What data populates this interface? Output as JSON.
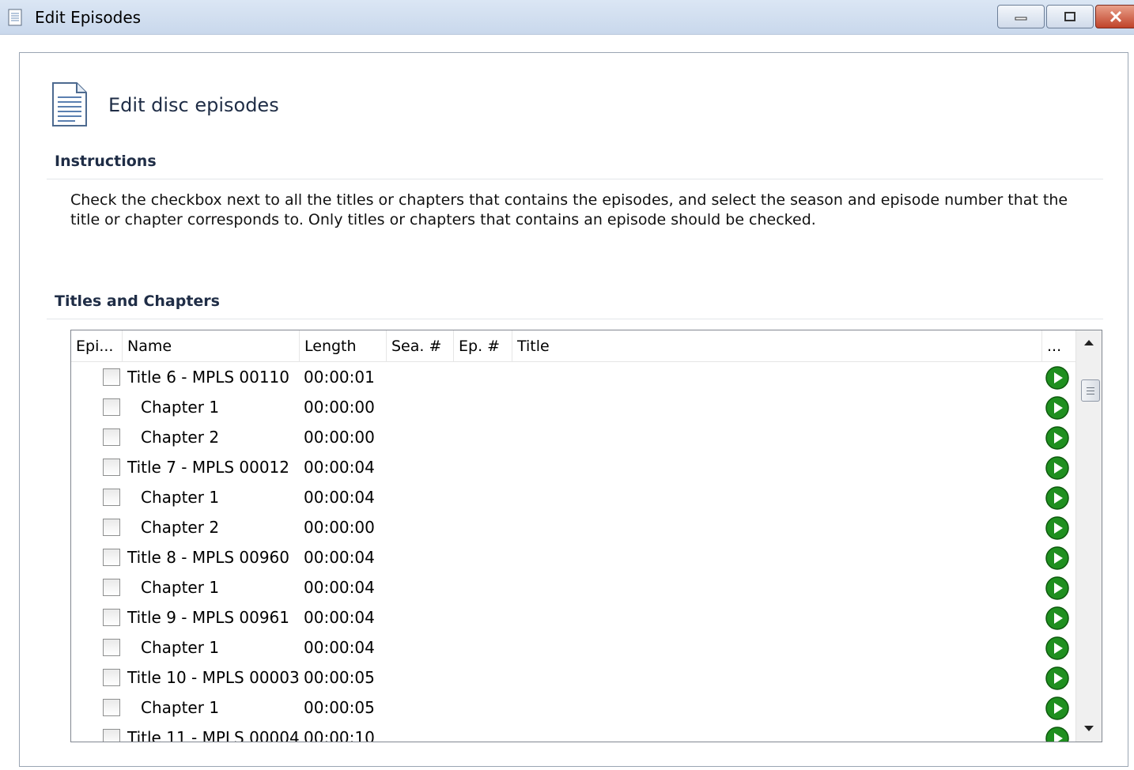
{
  "window": {
    "title": "Edit Episodes"
  },
  "header": {
    "title": "Edit disc episodes"
  },
  "instructions": {
    "label": "Instructions",
    "text": "Check the checkbox next to all the titles or chapters that contains the episodes, and select the season and episode number that the title or chapter corresponds to. Only titles or chapters that contains an episode should be checked."
  },
  "titles_section": {
    "label": "Titles and Chapters"
  },
  "columns": [
    "Epi...",
    "Name",
    "Length",
    "Sea. #",
    "Ep. #",
    "Title",
    "..."
  ],
  "rows": [
    {
      "name": "Title 6 - MPLS 00110",
      "length": "00:00:01",
      "level": 0,
      "checked": false
    },
    {
      "name": "Chapter 1",
      "length": "00:00:00",
      "level": 1,
      "checked": false
    },
    {
      "name": "Chapter 2",
      "length": "00:00:00",
      "level": 1,
      "checked": false
    },
    {
      "name": "Title 7 - MPLS 00012",
      "length": "00:00:04",
      "level": 0,
      "checked": false
    },
    {
      "name": "Chapter 1",
      "length": "00:00:04",
      "level": 1,
      "checked": false
    },
    {
      "name": "Chapter 2",
      "length": "00:00:00",
      "level": 1,
      "checked": false
    },
    {
      "name": "Title 8 - MPLS 00960",
      "length": "00:00:04",
      "level": 0,
      "checked": false
    },
    {
      "name": "Chapter 1",
      "length": "00:00:04",
      "level": 1,
      "checked": false
    },
    {
      "name": "Title 9 - MPLS 00961",
      "length": "00:00:04",
      "level": 0,
      "checked": false
    },
    {
      "name": "Chapter 1",
      "length": "00:00:04",
      "level": 1,
      "checked": false
    },
    {
      "name": "Title 10 - MPLS 00003",
      "length": "00:00:05",
      "level": 0,
      "checked": false
    },
    {
      "name": "Chapter 1",
      "length": "00:00:05",
      "level": 1,
      "checked": false
    },
    {
      "name": "Title 11 - MPLS 00004",
      "length": "00:00:10",
      "level": 0,
      "checked": false
    }
  ],
  "icons": {
    "app": "document-icon",
    "header": "document-icon",
    "row_action": "play-icon"
  },
  "colors": {
    "play_green": "#1f8f1f",
    "titlebar": "#c9d8ec"
  }
}
